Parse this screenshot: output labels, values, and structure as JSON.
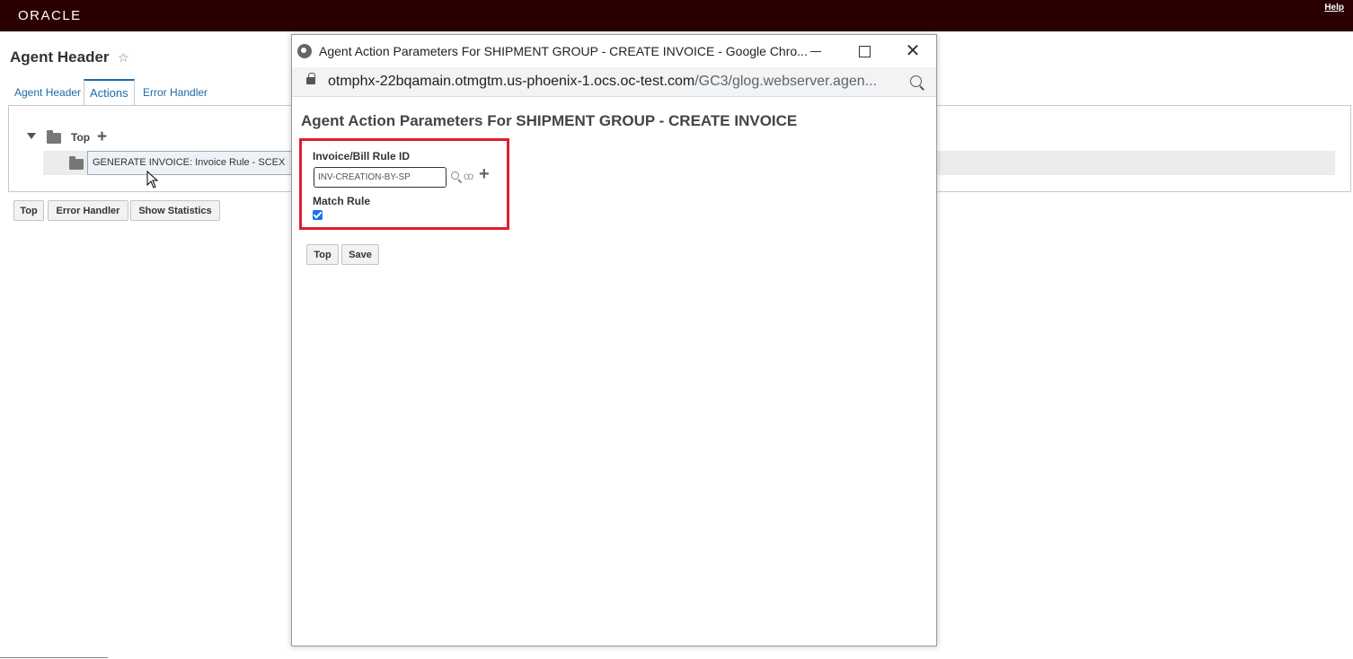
{
  "header": {
    "logo": "ORACLE",
    "help_label": "Help"
  },
  "page": {
    "title": "Agent Header",
    "tabs": [
      {
        "label": "Agent Header"
      },
      {
        "label": "Actions"
      },
      {
        "label": "Error Handler"
      }
    ],
    "tree": {
      "root_label": "Top",
      "item_label": "GENERATE INVOICE: Invoice Rule - SCEX"
    },
    "buttons": {
      "top": "Top",
      "error_handler": "Error Handler",
      "show_statistics": "Show Statistics"
    }
  },
  "popup": {
    "window_title": "Agent Action Parameters For SHIPMENT GROUP - CREATE INVOICE - Google Chro...",
    "url_host": "otmphx-22bqamain.otmgtm.us-phoenix-1.ocs.oc-test.com",
    "url_path": "/GC3/glog.webserver.agen...",
    "heading": "Agent Action Parameters For SHIPMENT GROUP - CREATE INVOICE",
    "fields": {
      "rule_id_label": "Invoice/Bill Rule ID",
      "rule_id_value": "INV-CREATION-BY-SP",
      "match_rule_label": "Match Rule",
      "match_rule_checked": true
    },
    "buttons": {
      "top": "Top",
      "save": "Save"
    }
  },
  "colors": {
    "topbar": "#2a0000",
    "highlight": "#e01e2b",
    "link": "#1d6aa5",
    "checkbox": "#1a73e8"
  }
}
